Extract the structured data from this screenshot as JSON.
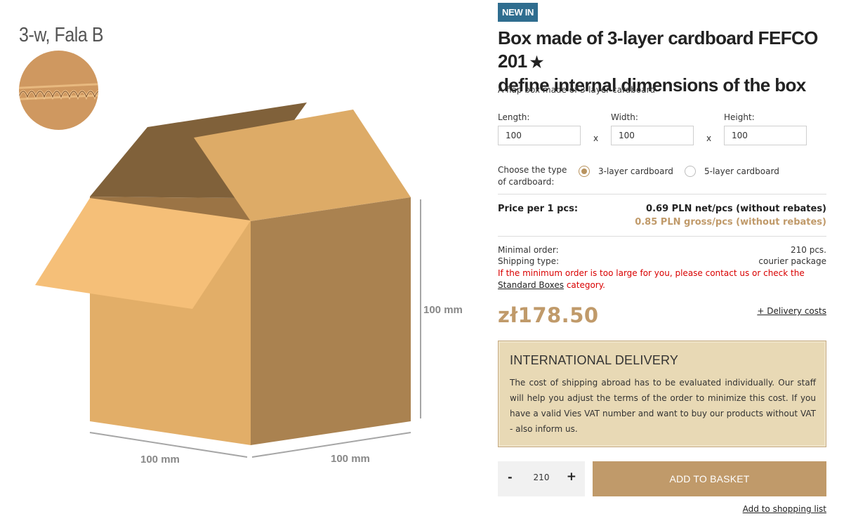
{
  "gallery": {
    "wave_type": "3-w, Fala B",
    "dim_height": "100 mm",
    "dim_length": "100 mm",
    "dim_width": "100 mm",
    "colors": {
      "box_front": "#e2ae68",
      "box_side": "#aa8250",
      "flap_light": "#f5bf78",
      "flap_dark": "#80613a",
      "flap_top": "#ddab67"
    }
  },
  "product": {
    "badge": "NEW IN",
    "title": "Box made of 3-layer cardboard FEFCO 201",
    "title_line2": "define internal dimensions of the box",
    "star": "★",
    "subtitle": "A flap box made of 3-layer cardboard"
  },
  "dimensions": {
    "length_label": "Length:",
    "length_value": "100",
    "width_label": "Width:",
    "width_value": "100",
    "height_label": "Height:",
    "height_value": "100",
    "separator": "x"
  },
  "cardboard": {
    "label": "Choose the type of cardboard:",
    "options": [
      {
        "label": "3-layer cardboard",
        "selected": true
      },
      {
        "label": "5-layer cardboard",
        "selected": false
      }
    ]
  },
  "pricing": {
    "label": "Price per 1 pcs:",
    "net": "0.69 PLN net/pcs (without rebates)",
    "gross": "0.85 PLN gross/pcs (without rebates)",
    "total": "zł178.50",
    "delivery_costs": "+ Delivery costs"
  },
  "order": {
    "minimal_label": "Minimal order:",
    "minimal_value": "210 pcs.",
    "shipping_label": "Shipping type:",
    "shipping_value": "courier package",
    "warning_prefix": "If the minimum order is too large for you, please contact us or check the",
    "warning_link": "Standard Boxes",
    "warning_suffix": "category."
  },
  "international": {
    "heading": "INTERNATIONAL DELIVERY",
    "text": "The cost of shipping abroad has to be evaluated individually. Our staff will help you adjust the terms of the order to minimize this cost. If you have a valid Vies VAT number and want to buy our products without VAT - also inform us."
  },
  "cart": {
    "minus": "-",
    "quantity": "210",
    "plus": "+",
    "add_label": "ADD TO BASKET",
    "shopping_list": "Add to shopping list"
  },
  "colors": {
    "accent": "#c09a6a",
    "badge": "#2f6d8f",
    "warning": "#d90000",
    "intl_bg": "#e8d9b5"
  }
}
